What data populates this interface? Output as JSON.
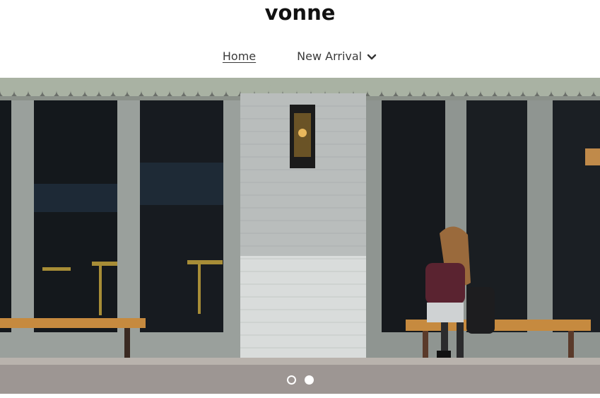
{
  "header": {
    "brand": "vonne"
  },
  "nav": {
    "items": [
      {
        "label": "Home",
        "active": true
      },
      {
        "label": "New Arrival",
        "has_dropdown": true
      }
    ]
  },
  "slideshow": {
    "slide_count": 2,
    "active_index": 1,
    "image_description": "storefront"
  },
  "colors": {
    "text": "#111111",
    "nav_text": "#3a3a3a",
    "dot": "#ffffff"
  }
}
